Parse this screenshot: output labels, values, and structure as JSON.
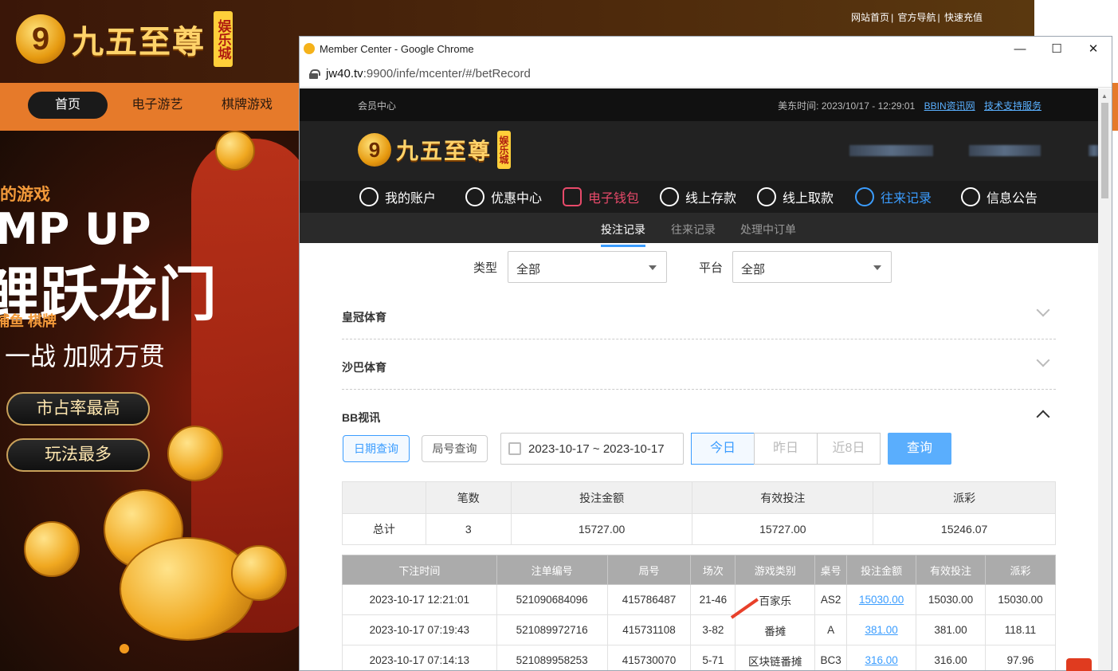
{
  "site": {
    "logo_text": "九五至尊",
    "logo_badge": "娱乐城",
    "logo_digit": "9",
    "top_links": [
      "网站首页",
      "官方导航",
      "快速充值"
    ],
    "nav": [
      "首页",
      "电子游艺",
      "棋牌游戏"
    ],
    "banner": {
      "line1": "的游戏",
      "line2": "MP UP",
      "line3": "鲤跃龙门",
      "line4": "捕鱼  棋牌",
      "line5": "一战  加财万贯",
      "pill1": "市占率最高",
      "pill2": "玩法最多"
    }
  },
  "window": {
    "title": "Member Center - Google Chrome",
    "url_host": "jw40.tv",
    "url_path": ":9900/infe/mcenter/#/betRecord",
    "btn_min": "—",
    "btn_max": "☐",
    "btn_close": "✕"
  },
  "member": {
    "top_left": "会员中心",
    "time_label": "美东时间: 2023/10/17 - 12:29:01",
    "link1": "BBIN资讯网",
    "link2": "技术支持服务",
    "nav": [
      {
        "label": "我的账户",
        "icon": "user-icon"
      },
      {
        "label": "优惠中心",
        "icon": "gift-icon"
      },
      {
        "label": "电子钱包",
        "icon": "wallet-icon"
      },
      {
        "label": "线上存款",
        "icon": "deposit-icon"
      },
      {
        "label": "线上取款",
        "icon": "withdraw-icon"
      },
      {
        "label": "往来记录",
        "icon": "record-icon"
      },
      {
        "label": "信息公告",
        "icon": "bell-icon"
      }
    ],
    "subnav": [
      "投注记录",
      "往来记录",
      "处理中订单"
    ],
    "filter": {
      "type_label": "类型",
      "type_value": "全部",
      "platform_label": "平台",
      "platform_value": "全部"
    },
    "sections": [
      "皇冠体育",
      "沙巴体育",
      "BB视讯"
    ],
    "query": {
      "date_btn": "日期查询",
      "round_btn": "局号查询",
      "date_range": "2023-10-17 ~ 2023-10-17",
      "today": "今日",
      "yesterday": "昨日",
      "last8": "近8日",
      "search": "查询"
    },
    "summary": {
      "headers": [
        "",
        "笔数",
        "投注金额",
        "有效投注",
        "派彩"
      ],
      "row": [
        "总计",
        "3",
        "15727.00",
        "15727.00",
        "15246.07"
      ]
    },
    "detail": {
      "headers": [
        "下注时间",
        "注单编号",
        "局号",
        "场次",
        "游戏类别",
        "桌号",
        "投注金额",
        "有效投注",
        "派彩"
      ],
      "rows": [
        [
          "2023-10-17 12:21:01",
          "521090684096",
          "415786487",
          "21-46",
          "百家乐",
          "AS2",
          "15030.00",
          "15030.00",
          "15030.00"
        ],
        [
          "2023-10-17 07:19:43",
          "521089972716",
          "415731108",
          "3-82",
          "番摊",
          "A",
          "381.00",
          "381.00",
          "118.11"
        ],
        [
          "2023-10-17 07:14:13",
          "521089958253",
          "415730070",
          "5-71",
          "区块链番摊",
          "BC3",
          "316.00",
          "316.00",
          "97.96"
        ]
      ]
    }
  },
  "colors": {
    "accent": "#3b9dff",
    "nav_orange": "#e67a2a",
    "wallet_red": "#e84a6a"
  }
}
